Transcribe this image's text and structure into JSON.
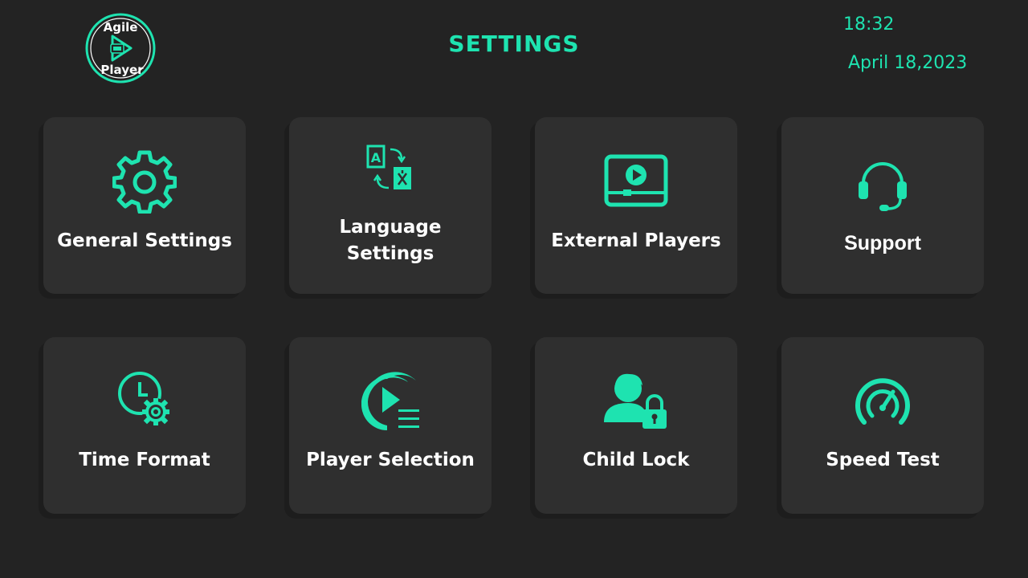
{
  "app": {
    "logo_text_top": "Agile",
    "logo_text_bottom": "Player"
  },
  "header": {
    "title": "SETTINGS",
    "time": "18:32",
    "date": "April 18,2023"
  },
  "colors": {
    "accent": "#1ee3b0",
    "background": "#232323",
    "tile": "#2f2f2f",
    "label": "#ffffff"
  },
  "tiles": [
    {
      "label": "General Settings",
      "icon": "gear-icon"
    },
    {
      "label_line1": "Language",
      "label_line2": "Settings",
      "icon": "language-translate-icon"
    },
    {
      "label": "External Players",
      "icon": "video-player-icon"
    },
    {
      "label": "Support",
      "icon": "headset-icon"
    },
    {
      "label": "Time Format",
      "icon": "clock-gear-icon"
    },
    {
      "label": "Player Selection",
      "icon": "play-list-icon"
    },
    {
      "label": "Child Lock",
      "icon": "child-lock-icon"
    },
    {
      "label": "Speed Test",
      "icon": "speedometer-icon"
    }
  ]
}
